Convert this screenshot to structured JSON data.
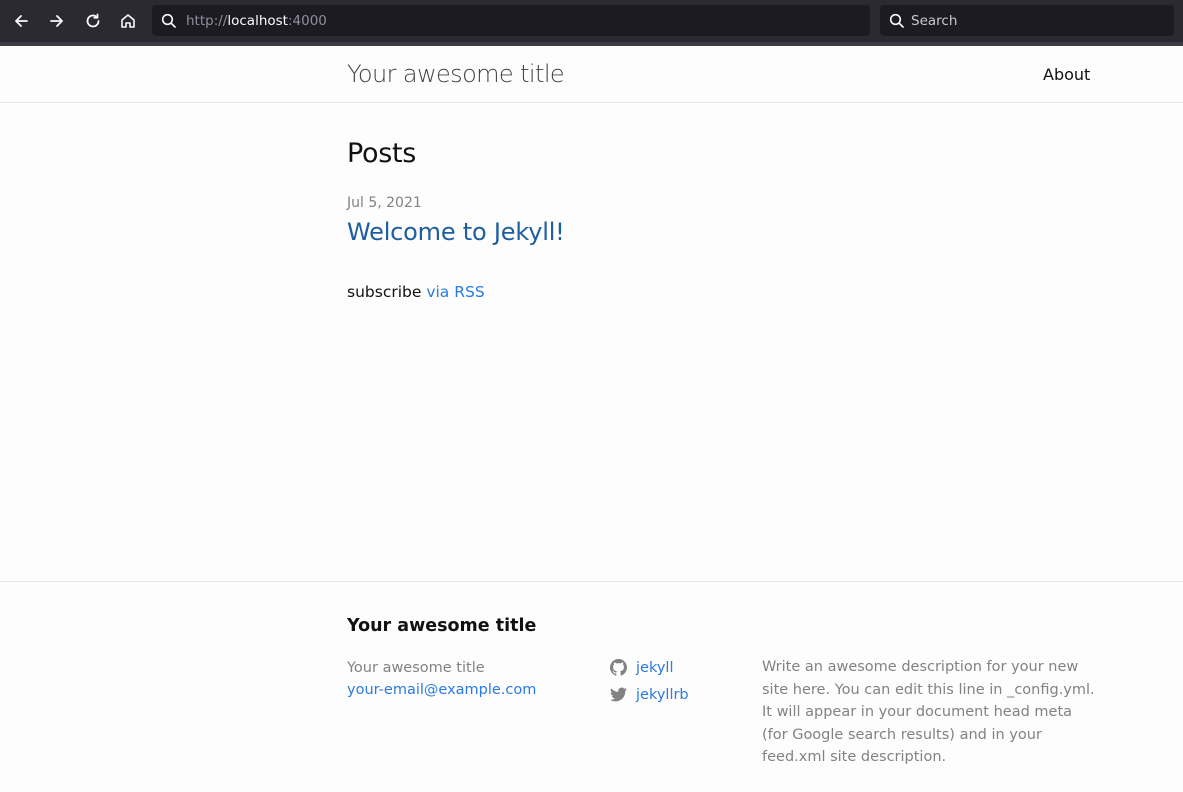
{
  "browser": {
    "url_scheme": "http://",
    "url_host": "localhost",
    "url_port": ":4000",
    "search_placeholder": "Search",
    "icons": [
      "back-arrow-icon",
      "forward-arrow-icon",
      "reload-icon",
      "home-icon",
      "search-icon"
    ]
  },
  "header": {
    "site_title": "Your awesome title",
    "nav": [
      {
        "label": "About"
      }
    ]
  },
  "main": {
    "heading": "Posts",
    "posts": [
      {
        "date": "Jul 5, 2021",
        "title": "Welcome to Jekyll!"
      }
    ],
    "subscribe_text": "subscribe ",
    "subscribe_link": "via RSS"
  },
  "footer": {
    "heading": "Your awesome title",
    "name": "Your awesome title",
    "email": "your-email@example.com",
    "social": [
      {
        "icon": "github-icon",
        "label": "jekyll"
      },
      {
        "icon": "twitter-icon",
        "label": "jekyllrb"
      }
    ],
    "description": "Write an awesome description for your new site here. You can edit this line in _config.yml. It will appear in your document head meta (for Google search results) and in your feed.xml site description."
  },
  "colors": {
    "chrome_bg": "#2b2a33",
    "field_bg": "#1c1b22",
    "link": "#2a7ae2",
    "muted": "#828282",
    "text": "#111111"
  }
}
